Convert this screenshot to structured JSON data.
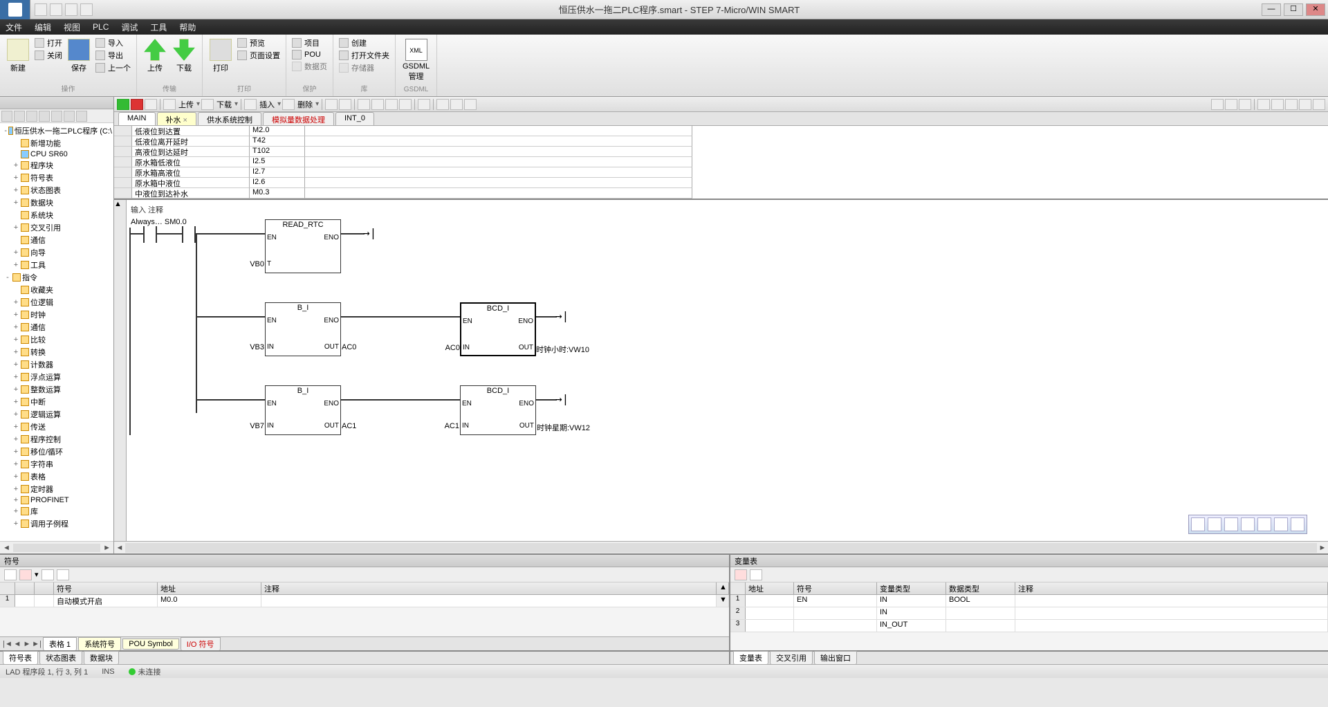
{
  "title": "恒压供水一拖二PLC程序.smart - STEP 7-Micro/WIN SMART",
  "menu": [
    "文件",
    "编辑",
    "视图",
    "PLC",
    "调试",
    "工具",
    "帮助"
  ],
  "ribbon": {
    "g1": {
      "big": "新建",
      "items": [
        "打开",
        "关闭"
      ],
      "items2": [
        "导入",
        "导出",
        "上一个"
      ],
      "label": "操作"
    },
    "g2": {
      "b1": "上传",
      "b2": "下载",
      "label": "传输"
    },
    "g3": {
      "big": "打印",
      "items": [
        "预览",
        "页面设置"
      ],
      "label": "打印"
    },
    "g4": {
      "items": [
        "项目",
        "POU"
      ],
      "dis": "数据页",
      "label": "保护"
    },
    "g5": {
      "items": [
        "创建",
        "打开文件夹",
        "存储器"
      ],
      "label": "库"
    },
    "g6": {
      "big": "GSDML\n管理",
      "label": "GSDML"
    }
  },
  "mainToolbar": {
    "upload": "上传",
    "download": "下载",
    "insert": "插入",
    "delete": "删除"
  },
  "tabs": [
    {
      "label": "MAIN",
      "cls": "active"
    },
    {
      "label": "补水",
      "cls": "yellow close"
    },
    {
      "label": "供水系统控制",
      "cls": ""
    },
    {
      "label": "模拟量数据处理",
      "cls": "red"
    },
    {
      "label": "INT_0",
      "cls": ""
    }
  ],
  "varTable": [
    {
      "n": "低液位到达置",
      "a": "M2.0"
    },
    {
      "n": "低液位离开延时",
      "a": "T42"
    },
    {
      "n": "高液位到达延时",
      "a": "T102"
    },
    {
      "n": "原水箱低液位",
      "a": "I2.5"
    },
    {
      "n": "原水箱高液位",
      "a": "I2.7"
    },
    {
      "n": "原水箱中液位",
      "a": "I2.6"
    },
    {
      "n": "中液位到达补水",
      "a": "M0.3"
    }
  ],
  "ladder": {
    "netLabel": "输入 注释",
    "contact": "Always… SM0.0",
    "fb1": {
      "title": "READ_RTC",
      "en": "EN",
      "eno": "ENO",
      "inL": "VB0",
      "inPort": "T"
    },
    "fb2": {
      "title": "B_I",
      "en": "EN",
      "eno": "ENO",
      "inL": "VB3",
      "inP": "IN",
      "outP": "OUT",
      "outR": "AC0"
    },
    "fb3": {
      "title": "BCD_I",
      "en": "EN",
      "eno": "ENO",
      "inL": "AC0",
      "inP": "IN",
      "outP": "OUT",
      "outR": "时钟小时:VW10"
    },
    "fb4": {
      "title": "B_I",
      "en": "EN",
      "eno": "ENO",
      "inL": "VB7",
      "inP": "IN",
      "outP": "OUT",
      "outR": "AC1"
    },
    "fb5": {
      "title": "BCD_I",
      "en": "EN",
      "eno": "ENO",
      "inL": "AC1",
      "inP": "IN",
      "outP": "OUT",
      "outR": "时钟星期:VW12"
    }
  },
  "tree": [
    {
      "t": "恒压供水一拖二PLC程序 (C:\\",
      "d": 0,
      "ex": "-",
      "ic": "dev"
    },
    {
      "t": "新增功能",
      "d": 1,
      "ic": ""
    },
    {
      "t": "CPU SR60",
      "d": 1,
      "ic": "dev"
    },
    {
      "t": "程序块",
      "d": 1,
      "ex": "+"
    },
    {
      "t": "符号表",
      "d": 1,
      "ex": "+"
    },
    {
      "t": "状态图表",
      "d": 1,
      "ex": "+"
    },
    {
      "t": "数据块",
      "d": 1,
      "ex": "+"
    },
    {
      "t": "系统块",
      "d": 1
    },
    {
      "t": "交叉引用",
      "d": 1,
      "ex": "+"
    },
    {
      "t": "通信",
      "d": 1
    },
    {
      "t": "向导",
      "d": 1,
      "ex": "+"
    },
    {
      "t": "工具",
      "d": 1,
      "ex": "+"
    },
    {
      "t": "指令",
      "d": 0,
      "ex": "-"
    },
    {
      "t": "收藏夹",
      "d": 1
    },
    {
      "t": "位逻辑",
      "d": 1,
      "ex": "+"
    },
    {
      "t": "时钟",
      "d": 1,
      "ex": "+"
    },
    {
      "t": "通信",
      "d": 1,
      "ex": "+"
    },
    {
      "t": "比较",
      "d": 1,
      "ex": "+"
    },
    {
      "t": "转换",
      "d": 1,
      "ex": "+"
    },
    {
      "t": "计数器",
      "d": 1,
      "ex": "+"
    },
    {
      "t": "浮点运算",
      "d": 1,
      "ex": "+"
    },
    {
      "t": "整数运算",
      "d": 1,
      "ex": "+"
    },
    {
      "t": "中断",
      "d": 1,
      "ex": "+"
    },
    {
      "t": "逻辑运算",
      "d": 1,
      "ex": "+"
    },
    {
      "t": "传送",
      "d": 1,
      "ex": "+"
    },
    {
      "t": "程序控制",
      "d": 1,
      "ex": "+"
    },
    {
      "t": "移位/循环",
      "d": 1,
      "ex": "+"
    },
    {
      "t": "字符串",
      "d": 1,
      "ex": "+"
    },
    {
      "t": "表格",
      "d": 1,
      "ex": "+"
    },
    {
      "t": "定时器",
      "d": 1,
      "ex": "+"
    },
    {
      "t": "PROFINET",
      "d": 1,
      "ex": "+"
    },
    {
      "t": "库",
      "d": 1,
      "ex": "+"
    },
    {
      "t": "调用子例程",
      "d": 1,
      "ex": "+"
    }
  ],
  "symPanel": {
    "title": "符号",
    "headers": {
      "c1": "符号",
      "c2": "地址",
      "c3": "注释"
    },
    "row": {
      "sym": "自动模式开启",
      "addr": "M0.0"
    },
    "tabs": [
      "表格 1",
      "系统符号",
      "POU Symbol",
      "I/O 符号"
    ],
    "bottomTabs": [
      "符号表",
      "状态图表",
      "数据块"
    ]
  },
  "varPanel": {
    "title": "变量表",
    "headers": {
      "c1": "地址",
      "c2": "符号",
      "c3": "变量类型",
      "c4": "数据类型",
      "c5": "注释"
    },
    "rows": [
      {
        "sym": "EN",
        "vt": "IN",
        "dt": "BOOL"
      },
      {
        "sym": "",
        "vt": "IN",
        "dt": ""
      },
      {
        "sym": "",
        "vt": "IN_OUT",
        "dt": ""
      }
    ],
    "bottomTabs": [
      "变量表",
      "交叉引用",
      "输出窗口"
    ]
  },
  "status": {
    "left": "LAD 程序段 1, 行 3, 列 1",
    "ins": "INS",
    "conn": "未连接"
  }
}
